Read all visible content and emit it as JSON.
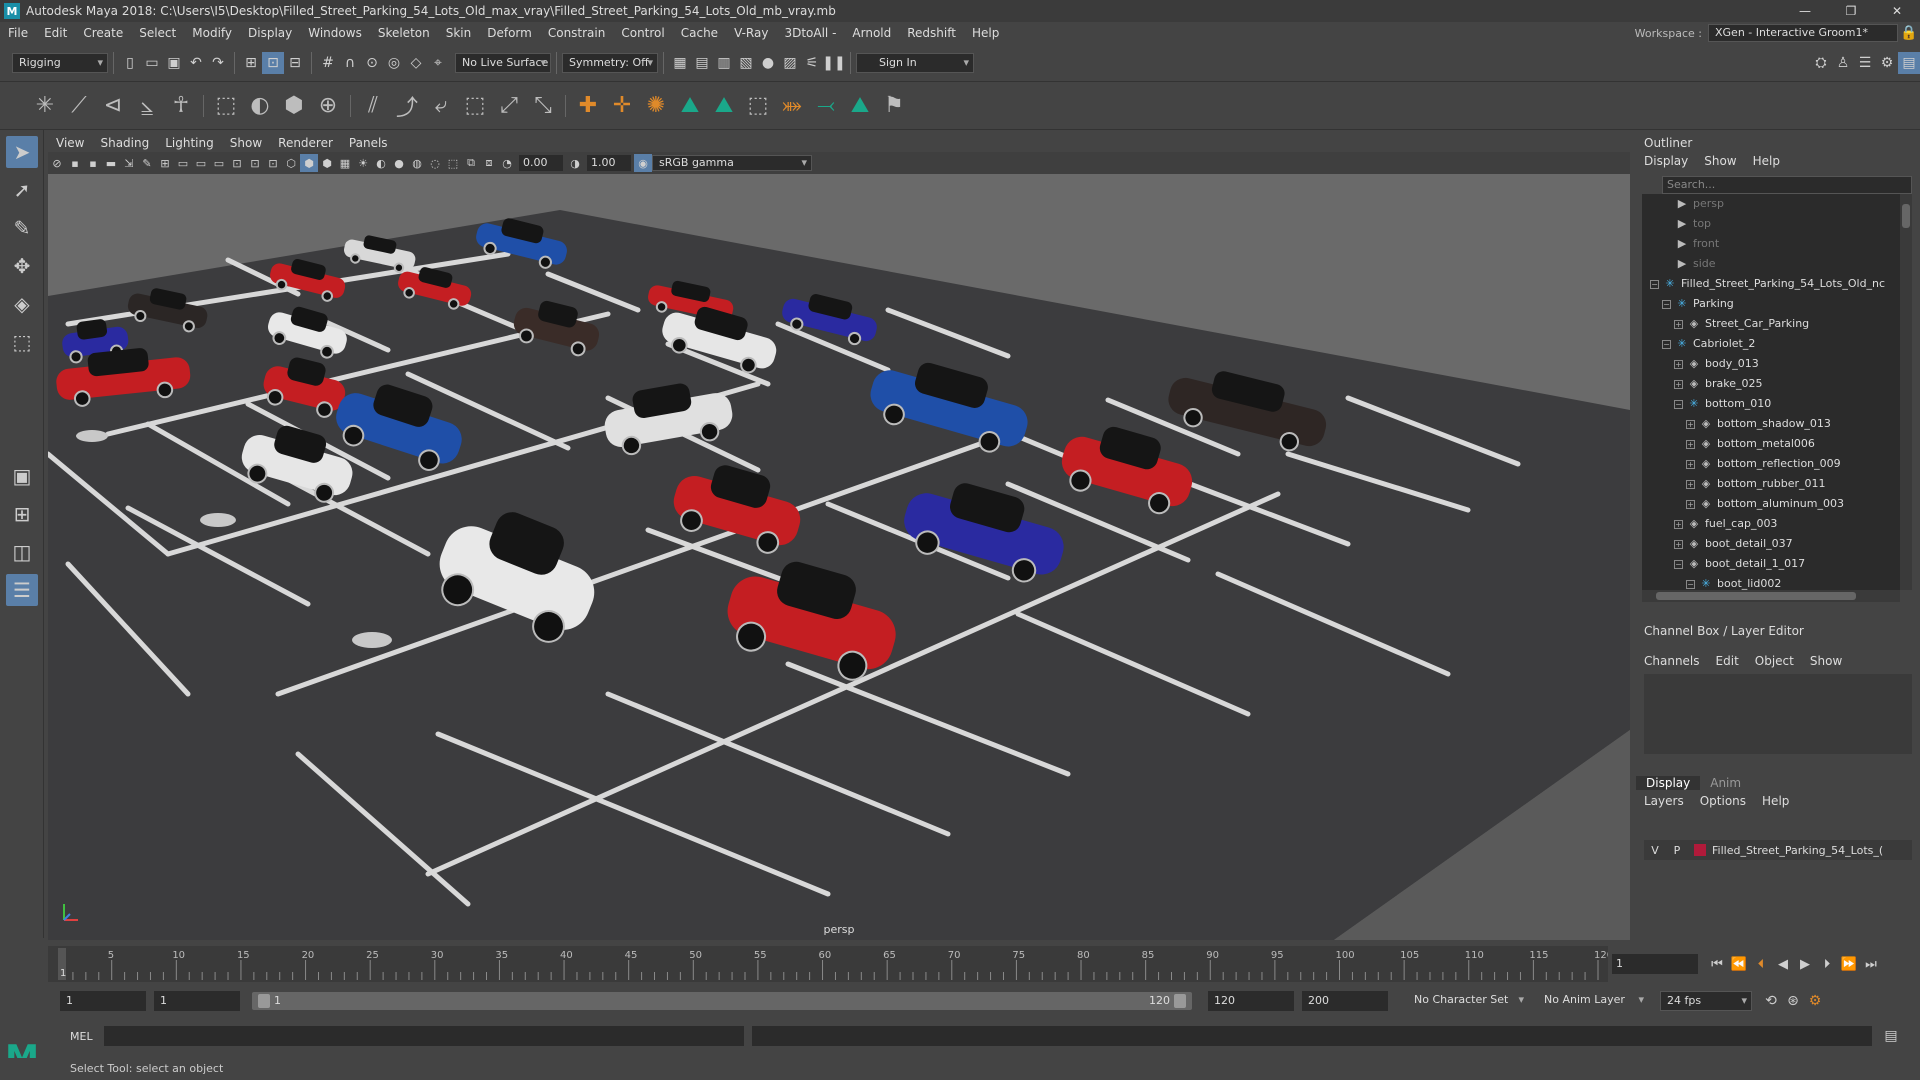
{
  "window": {
    "title": "Autodesk Maya 2018: C:\\Users\\I5\\Desktop\\Filled_Street_Parking_54_Lots_Old_max_vray\\Filled_Street_Parking_54_Lots_Old_mb_vray.mb",
    "logo": "M"
  },
  "menubar": {
    "items": [
      "File",
      "Edit",
      "Create",
      "Select",
      "Modify",
      "Display",
      "Windows",
      "Skeleton",
      "Skin",
      "Deform",
      "Constrain",
      "Control",
      "Cache",
      "V-Ray",
      "3DtoAll -",
      "Arnold",
      "Redshift",
      "Help"
    ]
  },
  "workspace": {
    "label": "Workspace :",
    "value": "XGen - Interactive Groom1*"
  },
  "statusline": {
    "mode": "Rigging",
    "live_surface": "No Live Surface",
    "symmetry": "Symmetry: Off",
    "sign_in": "Sign In"
  },
  "viewport_menu": {
    "items": [
      "View",
      "Shading",
      "Lighting",
      "Show",
      "Renderer",
      "Panels"
    ]
  },
  "viewport_toolbar": {
    "exposure": "0.00",
    "gamma": "1.00",
    "color_space": "sRGB gamma"
  },
  "viewport": {
    "camera_label": "persp"
  },
  "outliner": {
    "title": "Outliner",
    "menu": [
      "Display",
      "Show",
      "Help"
    ],
    "search_placeholder": "Search...",
    "items": [
      {
        "label": "persp",
        "icon": "camera-icon",
        "depth": 2,
        "dim": true
      },
      {
        "label": "top",
        "icon": "camera-icon",
        "depth": 2,
        "dim": true
      },
      {
        "label": "front",
        "icon": "camera-icon",
        "depth": 2,
        "dim": true
      },
      {
        "label": "side",
        "icon": "camera-icon",
        "depth": 2,
        "dim": true
      },
      {
        "label": "Filled_Street_Parking_54_Lots_Old_nc",
        "icon": "group-icon",
        "depth": 1,
        "toggle": "−"
      },
      {
        "label": "Parking",
        "icon": "group-icon",
        "depth": 2,
        "toggle": "−"
      },
      {
        "label": "Street_Car_Parking",
        "icon": "mesh-icon",
        "depth": 3,
        "toggle": "+"
      },
      {
        "label": "Cabriolet_2",
        "icon": "group-icon",
        "depth": 2,
        "toggle": "−"
      },
      {
        "label": "body_013",
        "icon": "mesh-icon",
        "depth": 3,
        "toggle": "+"
      },
      {
        "label": "brake_025",
        "icon": "mesh-icon",
        "depth": 3,
        "toggle": "+"
      },
      {
        "label": "bottom_010",
        "icon": "group-icon",
        "depth": 3,
        "toggle": "−"
      },
      {
        "label": "bottom_shadow_013",
        "icon": "mesh-icon",
        "depth": 4,
        "toggle": "+"
      },
      {
        "label": "bottom_metal006",
        "icon": "mesh-icon",
        "depth": 4,
        "toggle": "+"
      },
      {
        "label": "bottom_reflection_009",
        "icon": "mesh-icon",
        "depth": 4,
        "toggle": "+"
      },
      {
        "label": "bottom_rubber_011",
        "icon": "mesh-icon",
        "depth": 4,
        "toggle": "+"
      },
      {
        "label": "bottom_aluminum_003",
        "icon": "mesh-icon",
        "depth": 4,
        "toggle": "+"
      },
      {
        "label": "fuel_cap_003",
        "icon": "mesh-icon",
        "depth": 3,
        "toggle": "+"
      },
      {
        "label": "boot_detail_037",
        "icon": "mesh-icon",
        "depth": 3,
        "toggle": "+"
      },
      {
        "label": "boot_detail_1_017",
        "icon": "mesh-icon",
        "depth": 3,
        "toggle": "−"
      },
      {
        "label": "boot_lid002",
        "icon": "group-icon",
        "depth": 4,
        "toggle": "−"
      }
    ]
  },
  "channel_box": {
    "title": "Channel Box / Layer Editor",
    "menu": [
      "Channels",
      "Edit",
      "Object",
      "Show"
    ]
  },
  "layer_editor": {
    "tabs": [
      "Display",
      "Anim"
    ],
    "menu": [
      "Layers",
      "Options",
      "Help"
    ],
    "layer": {
      "v": "V",
      "p": "P",
      "name": "Filled_Street_Parking_54_Lots_(",
      "color": "#b01a3a"
    }
  },
  "timeline": {
    "ticks": [
      5,
      10,
      15,
      20,
      25,
      30,
      35,
      40,
      45,
      50,
      55,
      60,
      65,
      70,
      75,
      80,
      85,
      90,
      95,
      100,
      105,
      110,
      115,
      120
    ],
    "start": 1,
    "end": 120,
    "current_frame": "1",
    "first_label": "1"
  },
  "range": {
    "start": "1",
    "playback_start": "1",
    "bar_start": "1",
    "bar_end": "120",
    "playback_end": "120",
    "end": "200",
    "character_set": "No Character Set",
    "anim_layer": "No Anim Layer",
    "fps": "24 fps"
  },
  "command_line": {
    "label": "MEL"
  },
  "help_line": {
    "text": "Select Tool: select an object"
  },
  "cars": [
    {
      "color": "#2b2625"
    },
    {
      "color": "#c41e22"
    },
    {
      "color": "#d8d8d8"
    },
    {
      "color": "#c41e22"
    },
    {
      "color": "#1f4fa8"
    },
    {
      "color": "#e8e8e8"
    },
    {
      "color": "#2a2aa0"
    },
    {
      "color": "#c41e22"
    },
    {
      "color": "#c41e22"
    },
    {
      "color": "#3a2c28"
    },
    {
      "color": "#e6e6e6"
    },
    {
      "color": "#2a2aa0"
    },
    {
      "color": "#c41e22"
    },
    {
      "color": "#1f4fa8"
    },
    {
      "color": "#e0e0e0"
    },
    {
      "color": "#1f4fa8"
    },
    {
      "color": "#2e2624"
    },
    {
      "color": "#e6e6e6"
    },
    {
      "color": "#c41e22"
    },
    {
      "color": "#c41e22"
    },
    {
      "color": "#2a2aa0"
    },
    {
      "color": "#e8e8e8"
    },
    {
      "color": "#c41e22"
    }
  ]
}
